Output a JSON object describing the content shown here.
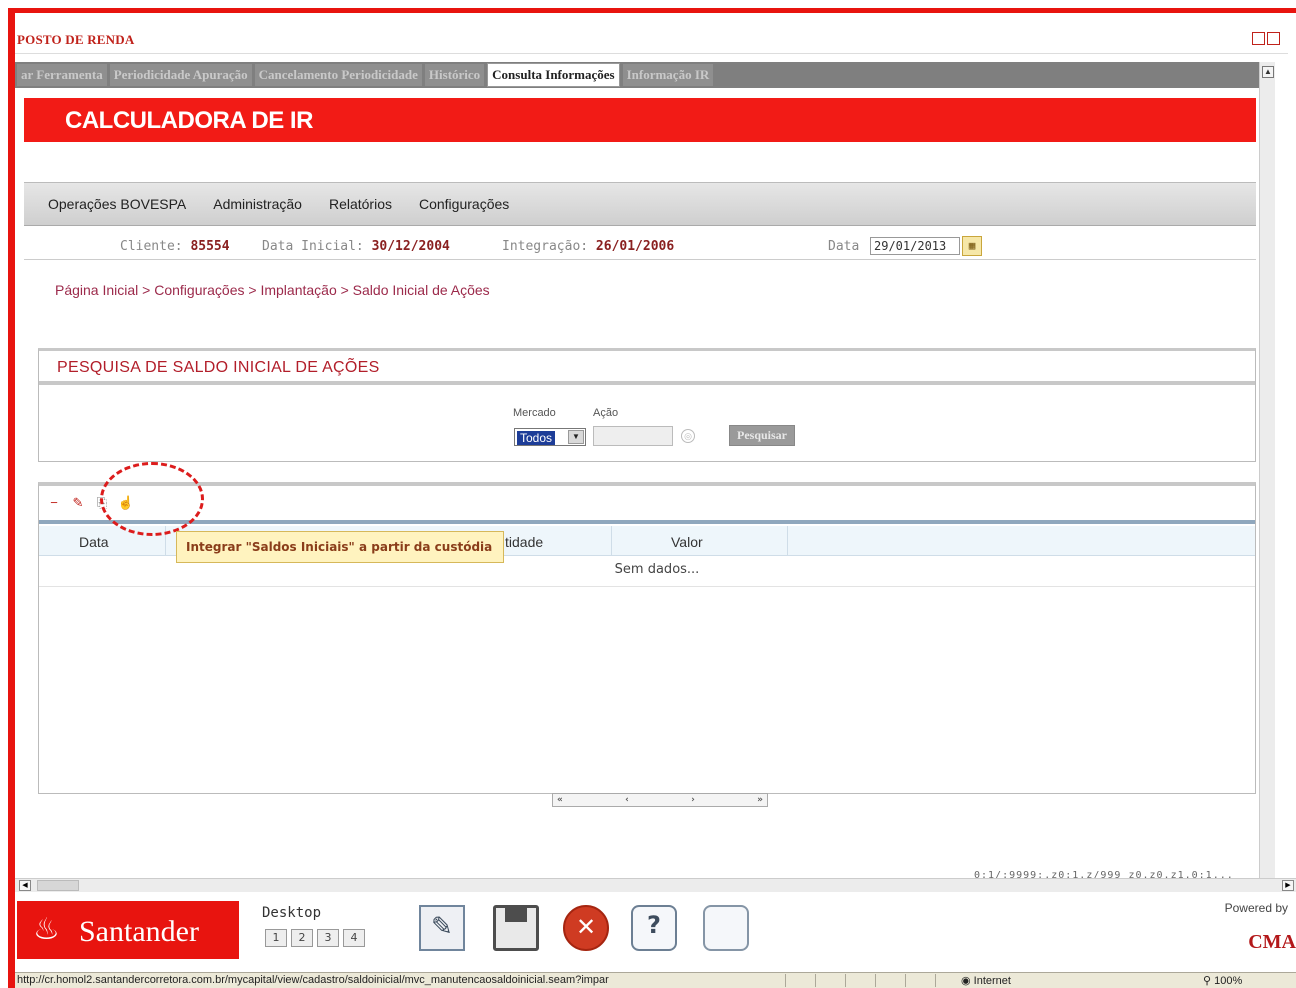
{
  "window": {
    "title": "POSTO DE RENDA"
  },
  "tabs": [
    {
      "label": "ar Ferramenta",
      "active": false
    },
    {
      "label": "Periodicidade Apuração",
      "active": false
    },
    {
      "label": "Cancelamento Periodicidade",
      "active": false
    },
    {
      "label": "Histórico",
      "active": false
    },
    {
      "label": "Consulta Informações",
      "active": true
    },
    {
      "label": "Informação IR",
      "active": false
    }
  ],
  "header": {
    "title": "CALCULADORA DE IR"
  },
  "nav": [
    "Operações BOVESPA",
    "Administração",
    "Relatórios",
    "Configurações"
  ],
  "info": {
    "cliente_label": "Cliente:",
    "cliente_value": "85554",
    "data_inicial_label": "Data Inicial:",
    "data_inicial_value": "30/12/2004",
    "integracao_label": "Integração:",
    "integracao_value": "26/01/2006",
    "data_label": "Data",
    "data_value": "29/01/2013"
  },
  "breadcrumb": "Página Inicial > Configurações > Implantação > Saldo Inicial de Ações",
  "search": {
    "title": "PESQUISA DE SALDO INICIAL DE AÇÕES",
    "mercado_label": "Mercado",
    "acao_label": "Ação",
    "mercado_value": "Todos",
    "acao_value": "",
    "button": "Pesquisar"
  },
  "table": {
    "columns": [
      "Data",
      "tidade",
      "Valor"
    ],
    "empty_text": "Sem dados..."
  },
  "tooltip": "Integrar \"Saldos Iniciais\" a partir da custódia",
  "pager": {
    "first": "«",
    "prev": "‹",
    "next": "›",
    "last": "»"
  },
  "status_fragment": "0:1/:9999:.z0:1.z/999 z0.z0.z1.0:1...",
  "bottom": {
    "brand": "Santander",
    "desktop_label": "Desktop",
    "desktops": [
      "1",
      "2",
      "3",
      "4"
    ],
    "powered_by": "Powered by",
    "powered_brand": "CMA"
  },
  "statusbar": {
    "url": "http://cr.homol2.santandercorretora.com.br/mycapital/view/cadastro/saldoinicial/mvc_manutencaosaldoinicial.seam?impar",
    "zone": "Internet",
    "zoom": "100%"
  },
  "icons": [
    "edit-icon",
    "save-icon",
    "close-icon",
    "help-icon",
    "chat-icon",
    "calendar-icon"
  ],
  "colors": {
    "brand_red": "#f21b16",
    "tooltip_bg": "#fff3bf",
    "selected_blue": "#1d3d98"
  }
}
